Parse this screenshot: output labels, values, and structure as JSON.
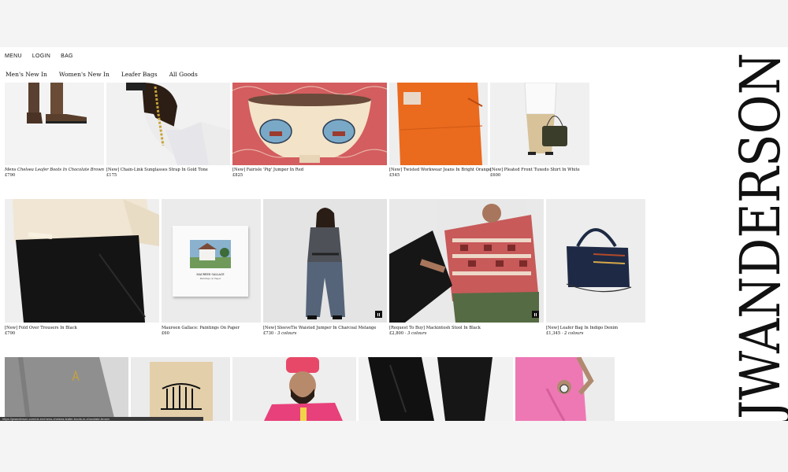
{
  "nav": {
    "menu": "MENU",
    "login": "LOGIN",
    "bag": "BAG"
  },
  "categories": [
    "Men's New In",
    "Women's New In",
    "Leafer Bags",
    "All Goods"
  ],
  "brand": "JWANDERSON",
  "row1": [
    {
      "name": "Mens Chelsea Leafer Boots In Chocolate Brown",
      "price": "£790",
      "italic": true
    },
    {
      "name": "[New] Chain-Link Sunglasses Strap In Gold Tone",
      "price": "£175"
    },
    {
      "name": "[New] Fairisle 'Pig' Jumper In Red",
      "price": "£825"
    },
    {
      "name": "[New] Twisted Workwear Jeans In Bright Orange",
      "price": "£545"
    },
    {
      "name": "[New] Pleated Front Tuxedo Shirt In White",
      "price": "£600"
    }
  ],
  "row2": [
    {
      "name": "[New] Fold Over Trousers In Black",
      "price": "£790"
    },
    {
      "name": "Maureen Gallace: Paintings On Paper",
      "price": "£60"
    },
    {
      "name": "[New] SleeveTie Waisted Jumper In Charcoal Melange",
      "price": "£730",
      "extra": "3 colours"
    },
    {
      "name": "[Request To Buy] Mackintosh Stool In Black",
      "price": "£2,800",
      "extra": "3 colours"
    },
    {
      "name": "[New] Leafer Bag In Indigo Denim",
      "price": "£1,345",
      "extra": "2 colours"
    }
  ],
  "book": {
    "title": "MAUREEN GALLACE",
    "subtitle": "Paintings on Paper"
  },
  "status_url": "https://jwanderson.com/uk-en/mens-chelsea-leafer-boots-in-chocolate-brown"
}
